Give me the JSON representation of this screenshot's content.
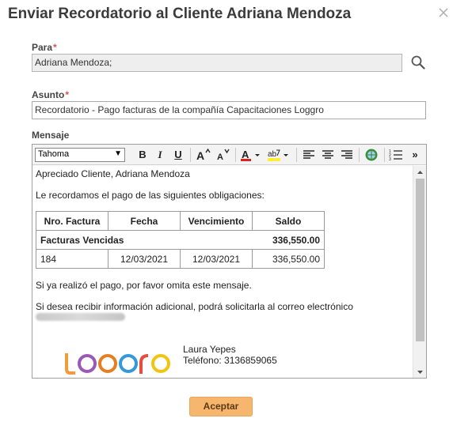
{
  "dialog": {
    "title": "Enviar Recordatorio al Cliente Adriana Mendoza",
    "close_icon": "close-icon"
  },
  "form": {
    "para_label": "Para",
    "para_value": "Adriana Mendoza;",
    "asunto_label": "Asunto",
    "asunto_value": "Recordatorio - Pago facturas de la compañía Capacitaciones Loggro",
    "mensaje_label": "Mensaje",
    "required_mark": "*"
  },
  "toolbar": {
    "font": "Tahoma",
    "bold": "B",
    "italic": "I",
    "underline": "U",
    "more": "»"
  },
  "message": {
    "greeting": "Apreciado Cliente, Adriana Mendoza",
    "intro": "Le recordamos el pago de las siguientes obligaciones:",
    "table": {
      "headers": [
        "Nro. Factura",
        "Fecha",
        "Vencimiento",
        "Saldo"
      ],
      "group_label": "Facturas Vencidas",
      "group_total": "336,550.00",
      "rows": [
        {
          "nro": "184",
          "fecha": "12/03/2021",
          "vencimiento": "12/03/2021",
          "saldo": "336,550.00"
        }
      ]
    },
    "paid_note": "Si ya realizó el pago, por favor omita este mensaje.",
    "info_note": "Si desea recibir información adicional, podrá solicitarla al correo electrónico",
    "signature_name": "Laura Yepes",
    "signature_phone_label": "Teléfono: 3136859065"
  },
  "footer": {
    "accept_label": "Aceptar"
  },
  "colors": {
    "accent_button": "#f6b66d",
    "required": "#d9534f",
    "logo_orange": "#f39a3b",
    "logo_purple": "#7b5ea7"
  }
}
